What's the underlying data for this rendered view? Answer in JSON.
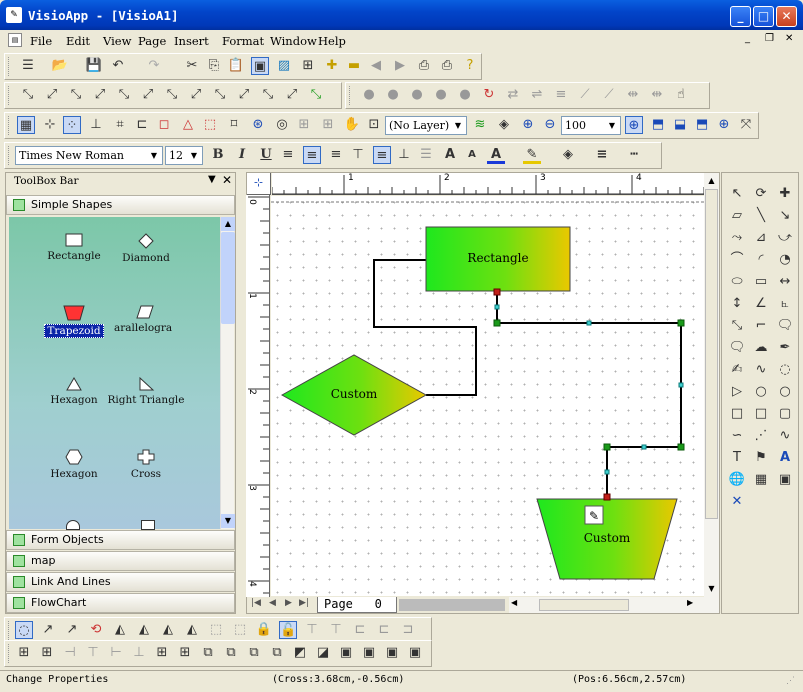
{
  "window": {
    "title": "VisioApp - [VisioA1]",
    "app_icon": "visio-app-icon"
  },
  "menu": [
    "File",
    "Edit",
    "View",
    "Page",
    "Insert",
    "Format",
    "Window",
    "Help"
  ],
  "toolbar_layer": {
    "value": "(No Layer)"
  },
  "toolbar_zoom": {
    "value": "100"
  },
  "font_toolbar": {
    "font": "Times New Roman",
    "size": "12",
    "bold": "B",
    "italic": "I",
    "underline": "U",
    "text_a": "A"
  },
  "toolbox": {
    "title": "ToolBox Bar",
    "sections": [
      "Simple Shapes",
      "Form Objects",
      "map",
      "Link And Lines",
      "FlowChart"
    ],
    "shapes": [
      {
        "label": "Rectangle",
        "icon": "rectangle-icon"
      },
      {
        "label": "Diamond",
        "icon": "diamond-icon"
      },
      {
        "label": "Trapezoid",
        "icon": "trapezoid-icon",
        "selected": true
      },
      {
        "label": "arallelogra",
        "icon": "parallelogram-icon"
      },
      {
        "label": "Hexagon",
        "icon": "triangle-icon"
      },
      {
        "label": "Right Triangle",
        "icon": "right-triangle-icon"
      },
      {
        "label": "Hexagon",
        "icon": "hexagon-icon"
      },
      {
        "label": "Cross",
        "icon": "cross-icon"
      }
    ]
  },
  "ruler": {
    "h_ticks": [
      "1",
      "2",
      "3",
      "4"
    ],
    "v_ticks": [
      "0",
      "1",
      "2",
      "3",
      "4"
    ]
  },
  "canvas": {
    "shapes": [
      {
        "label": "Rectangle"
      },
      {
        "label": "Custom"
      },
      {
        "label": "Custom"
      }
    ]
  },
  "page_tab": {
    "label": "Page",
    "number": "0"
  },
  "status": {
    "left": "Change Properties",
    "cross": "(Cross:3.68cm,-0.56cm)",
    "pos": "(Pos:6.56cm,2.57cm)"
  },
  "colors": {
    "title_blue": "#0244c9",
    "grad_green": "#1ee81e",
    "grad_yellow": "#e6c800",
    "selection": "#0a24a8"
  }
}
